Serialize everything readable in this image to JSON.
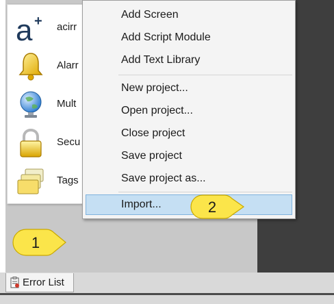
{
  "components": [
    {
      "label": "acirr",
      "icon": "acirro-logo-icon"
    },
    {
      "label": "Alarr",
      "icon": "bell-icon"
    },
    {
      "label": "Mult",
      "icon": "globe-icon"
    },
    {
      "label": "Secu",
      "icon": "padlock-icon"
    },
    {
      "label": "Tags",
      "icon": "folders-icon"
    }
  ],
  "menu": {
    "items": [
      {
        "label": "Add Screen"
      },
      {
        "label": "Add Script Module"
      },
      {
        "label": "Add Text Library"
      },
      {
        "label": "New project..."
      },
      {
        "label": "Open project..."
      },
      {
        "label": "Close project"
      },
      {
        "label": "Save project"
      },
      {
        "label": "Save project as..."
      },
      {
        "label": "Import..."
      }
    ],
    "highlighted_item": "Import..."
  },
  "bottom_tab": {
    "label": "Error List",
    "icon": "error-list-icon"
  },
  "callouts": [
    {
      "number": "1"
    },
    {
      "number": "2"
    }
  ],
  "colors": {
    "highlight": "#c5dff3",
    "highlight_border": "#7fb2dd",
    "callout_fill": "#fbe54a",
    "dark_panel": "#3e3e3e"
  }
}
